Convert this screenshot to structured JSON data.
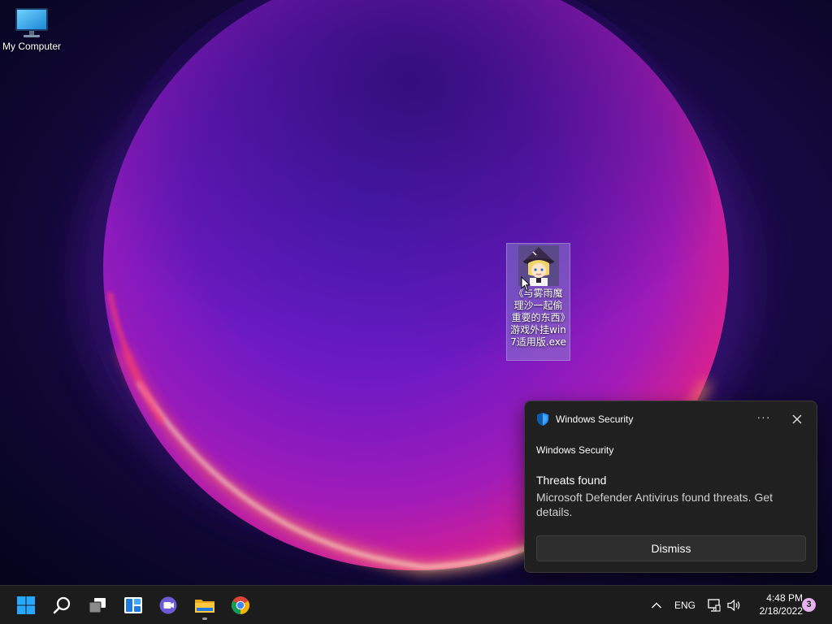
{
  "desktop": {
    "icons": [
      {
        "label": "My Computer",
        "icon": "monitor-icon"
      },
      {
        "label": "《与雾雨魔理沙一起偷重要的东西》游戏外挂win7适用版.exe",
        "icon": "anime-character-app-icon"
      }
    ]
  },
  "toast": {
    "header_app": "Windows Security",
    "more_label": "···",
    "app_name": "Windows Security",
    "title": "Threats found",
    "body": "Microsoft Defender Antivirus found threats. Get details.",
    "dismiss_label": "Dismiss",
    "icons": [
      "windows-security-shield-icon",
      "more-options-icon",
      "close-icon"
    ]
  },
  "taskbar": {
    "apps": [
      {
        "name": "start",
        "icon": "windows-start-icon"
      },
      {
        "name": "search",
        "icon": "search-icon"
      },
      {
        "name": "task-view",
        "icon": "task-view-icon"
      },
      {
        "name": "widgets",
        "icon": "widgets-icon"
      },
      {
        "name": "chat",
        "icon": "teams-chat-icon"
      },
      {
        "name": "file-explorer",
        "icon": "folder-icon",
        "running": true
      },
      {
        "name": "chrome",
        "icon": "chrome-icon"
      }
    ],
    "tray": {
      "language": "ENG",
      "time": "4:48 PM",
      "date": "2/18/2022",
      "notification_count": "3"
    }
  },
  "colors": {
    "taskbar_bg": "#1c1c1c",
    "toast_bg": "#202020",
    "accent_blue": "#0078d4",
    "badge": "#e6b3ee"
  }
}
